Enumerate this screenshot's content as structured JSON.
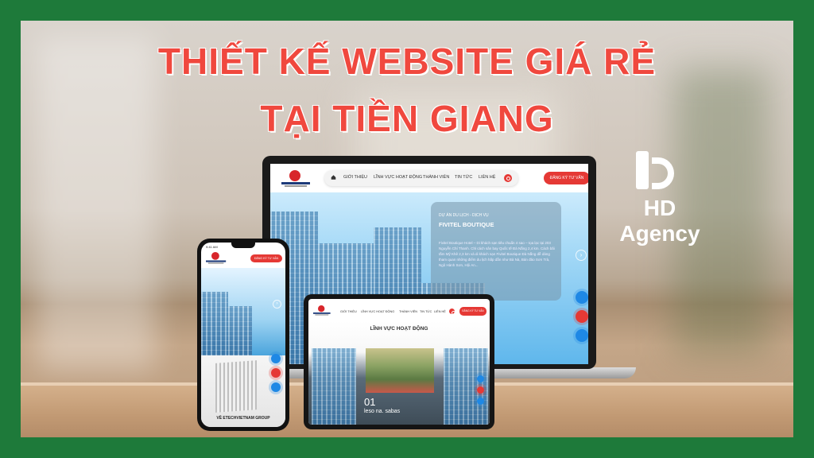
{
  "headline": {
    "line1": "THIẾT KẾ WEBSITE GIÁ RẺ",
    "line2": "TẠI TIỀN GIANG"
  },
  "brand": {
    "name": "HD Agency"
  },
  "colors": {
    "frame": "#1e7a3a",
    "headline": "#f0483e",
    "accent_red": "#e53935",
    "accent_blue": "#1e88e5"
  },
  "laptop": {
    "nav": {
      "items": [
        "GIỚI THIỆU",
        "LĨNH VỰC HOẠT ĐỘNG",
        "THÀNH VIÊN",
        "TIN TỨC",
        "LIÊN HỆ"
      ],
      "cta": "ĐĂNG KÝ TƯ VẤN"
    },
    "card": {
      "kicker": "DỰ ÁN DU LỊCH - DỊCH VỤ",
      "title": "FIVITEL BOUTIQUE",
      "body": "Fivitel Boutique Hotel – Di khách sạn tiêu chuẩn 4 sao – tọa lạc tại 203 Nguyễn Chí Thanh. Chỉ cách sân bay Quốc tế Đà Nẵng 2,4 km. Cách bãi tắm Mỹ Khê 2,3 km và di khách sạn Fivitel Boutique Đà Nẵng dễ dàng tham quan những điểm du lịch hấp dẫn như Bà Nà, Bán đảo Sơn Trà, Ngũ Hành Sơn, Hội An..."
    },
    "arrow": "›"
  },
  "phone": {
    "time": "9:41 AM",
    "cta": "ĐĂNG KÝ TƯ VẤN",
    "section_title": "VỀ ETECHVIETNAM GROUP"
  },
  "tablet": {
    "nav": {
      "items": [
        "GIỚI THIỆU",
        "LĨNH VỰC HOẠT ĐỘNG",
        "THÀNH VIÊN",
        "TIN TỨC",
        "LIÊN HỆ"
      ],
      "cta": "ĐĂNG KÝ TƯ VẤN"
    },
    "section_title": "LĨNH VỰC HOẠT ĐỘNG",
    "number": "01",
    "caption": "leso na. sabas"
  }
}
